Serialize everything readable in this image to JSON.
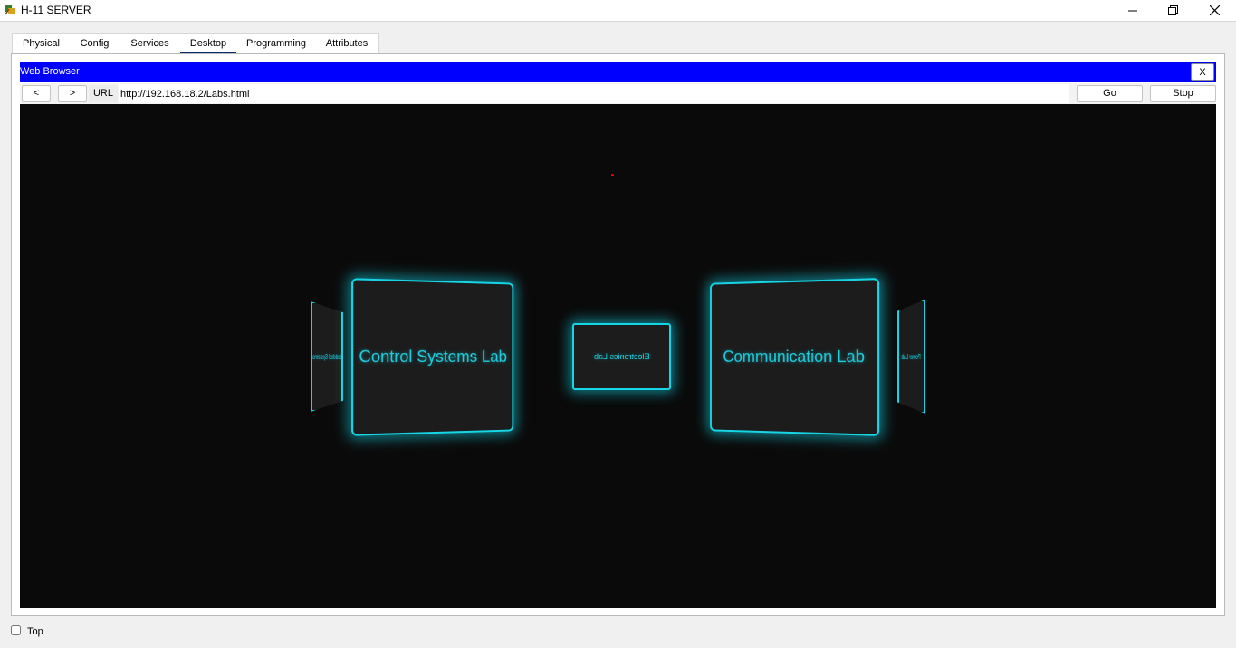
{
  "window": {
    "title": "H-11 SERVER"
  },
  "tabs": [
    {
      "label": "Physical"
    },
    {
      "label": "Config"
    },
    {
      "label": "Services"
    },
    {
      "label": "Desktop",
      "active": true
    },
    {
      "label": "Programming"
    },
    {
      "label": "Attributes"
    }
  ],
  "browser": {
    "title": "Web Browser",
    "close_label": "X",
    "back_label": "<",
    "forward_label": ">",
    "url_label": "URL",
    "url_value": "http://192.168.18.2/Labs.html",
    "go_label": "Go",
    "stop_label": "Stop"
  },
  "carousel": {
    "accent_color": "#16d6e6",
    "cards": [
      {
        "label": "Embedded Systems Lab"
      },
      {
        "label": "Control Systems Lab"
      },
      {
        "label": "Electronics Lab"
      },
      {
        "label": "Communication Lab"
      },
      {
        "label": "Power Lab"
      }
    ]
  },
  "footer": {
    "top_label": "Top",
    "top_checked": false
  }
}
